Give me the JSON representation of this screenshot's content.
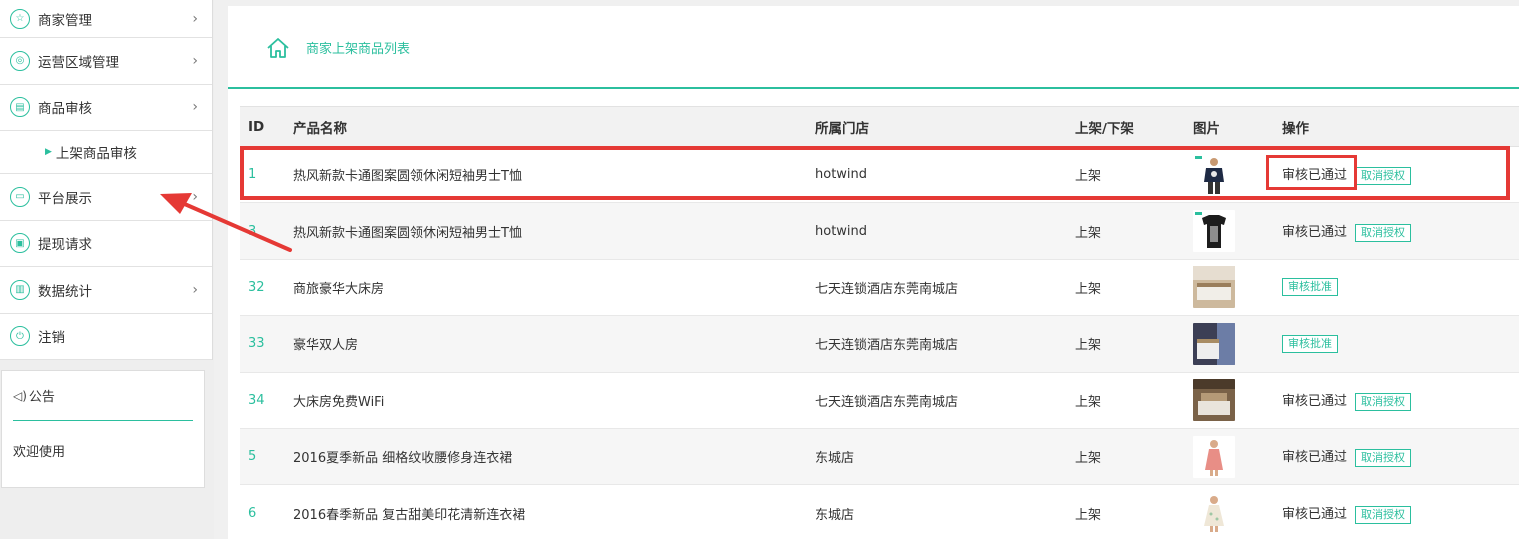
{
  "sidebar": {
    "items": [
      {
        "label": "商家管理",
        "icon": "star-icon",
        "glyph": "☆",
        "has_arrow": true
      },
      {
        "label": "运营区域管理",
        "icon": "location-pin-icon",
        "glyph": "◎",
        "has_arrow": true
      },
      {
        "label": "商品审核",
        "icon": "document-icon",
        "glyph": "▤",
        "has_arrow": true
      },
      {
        "label": "平台展示",
        "icon": "display-icon",
        "glyph": "▭",
        "has_arrow": true
      },
      {
        "label": "提现请求",
        "icon": "wallet-icon",
        "glyph": "▣",
        "has_arrow": false
      },
      {
        "label": "数据统计",
        "icon": "bar-chart-icon",
        "glyph": "▥",
        "has_arrow": true
      },
      {
        "label": "注销",
        "icon": "power-icon",
        "glyph": "⏻",
        "has_arrow": false
      }
    ],
    "subitem": {
      "label": "上架商品审核"
    },
    "chevron": "›",
    "notice": {
      "title": "公告",
      "body": "欢迎使用"
    }
  },
  "breadcrumb": {
    "label": "商家上架商品列表"
  },
  "table": {
    "headers": {
      "id": "ID",
      "name": "产品名称",
      "shop": "所属门店",
      "updown": "上架/下架",
      "pic": "图片",
      "ops": "操作"
    },
    "rows": [
      {
        "id": "1",
        "name": "热风新款卡通图案圆领休闲短袖男士T恤",
        "shop": "hotwind",
        "updown": "上架",
        "pic": "tshirt-man",
        "status": "审核已通过",
        "button": "取消授权"
      },
      {
        "id": "3",
        "name": "热风新款卡通图案圆领休闲短袖男士T恤",
        "shop": "hotwind",
        "updown": "上架",
        "pic": "tshirt-dark",
        "status": "审核已通过",
        "button": "取消授权"
      },
      {
        "id": "32",
        "name": "商旅豪华大床房",
        "shop": "七天连锁酒店东莞南城店",
        "updown": "上架",
        "pic": "hotel-room-1",
        "status": "",
        "button": "审核批准"
      },
      {
        "id": "33",
        "name": "豪华双人房",
        "shop": "七天连锁酒店东莞南城店",
        "updown": "上架",
        "pic": "hotel-room-2",
        "status": "",
        "button": "审核批准"
      },
      {
        "id": "34",
        "name": "大床房免费WiFi",
        "shop": "七天连锁酒店东莞南城店",
        "updown": "上架",
        "pic": "hotel-room-3",
        "status": "审核已通过",
        "button": "取消授权"
      },
      {
        "id": "5",
        "name": "2016夏季新品 细格纹收腰修身连衣裙",
        "shop": "东城店",
        "updown": "上架",
        "pic": "dress-pink",
        "status": "审核已通过",
        "button": "取消授权"
      },
      {
        "id": "6",
        "name": "2016春季新品 复古甜美印花清新连衣裙",
        "shop": "东城店",
        "updown": "上架",
        "pic": "dress-white",
        "status": "审核已通过",
        "button": "取消授权"
      }
    ]
  },
  "colors": {
    "accent": "#2bbf9e",
    "annotation": "#e53935"
  }
}
